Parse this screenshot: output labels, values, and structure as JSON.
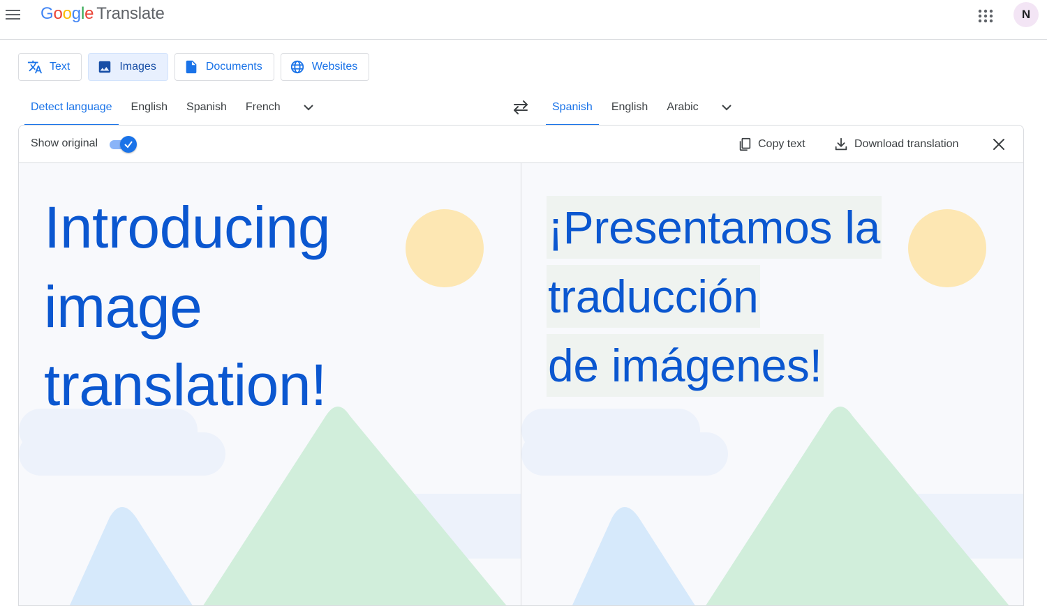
{
  "header": {
    "logo_letters": [
      "G",
      "o",
      "o",
      "g",
      "l",
      "e"
    ],
    "product": "Translate",
    "avatar_initial": "N",
    "icons": {
      "menu": "hamburger-menu-icon",
      "apps": "apps-grid-icon"
    }
  },
  "mode_tabs": [
    {
      "label": "Text",
      "icon": "translate-icon",
      "active": false
    },
    {
      "label": "Images",
      "icon": "image-icon",
      "active": true
    },
    {
      "label": "Documents",
      "icon": "document-icon",
      "active": false
    },
    {
      "label": "Websites",
      "icon": "globe-icon",
      "active": false
    }
  ],
  "source_languages": [
    "Detect language",
    "English",
    "Spanish",
    "French"
  ],
  "source_active": "Detect language",
  "target_languages": [
    "Spanish",
    "English",
    "Arabic"
  ],
  "target_active": "Spanish",
  "toolbar": {
    "show_original_label": "Show original",
    "show_original_on": true,
    "copy_label": "Copy text",
    "download_label": "Download translation"
  },
  "original_image_text": [
    "Introducing",
    "image",
    "translation!"
  ],
  "translated_image_text": [
    "¡Presentamos la",
    "traducción",
    "de imágenes!"
  ],
  "colors": {
    "accent": "#1a73e8",
    "image_text": "#0b57d0",
    "sun": "#fde7b3",
    "mountain_green": "#d1eedb",
    "mountain_blue": "#d6e9fb"
  }
}
